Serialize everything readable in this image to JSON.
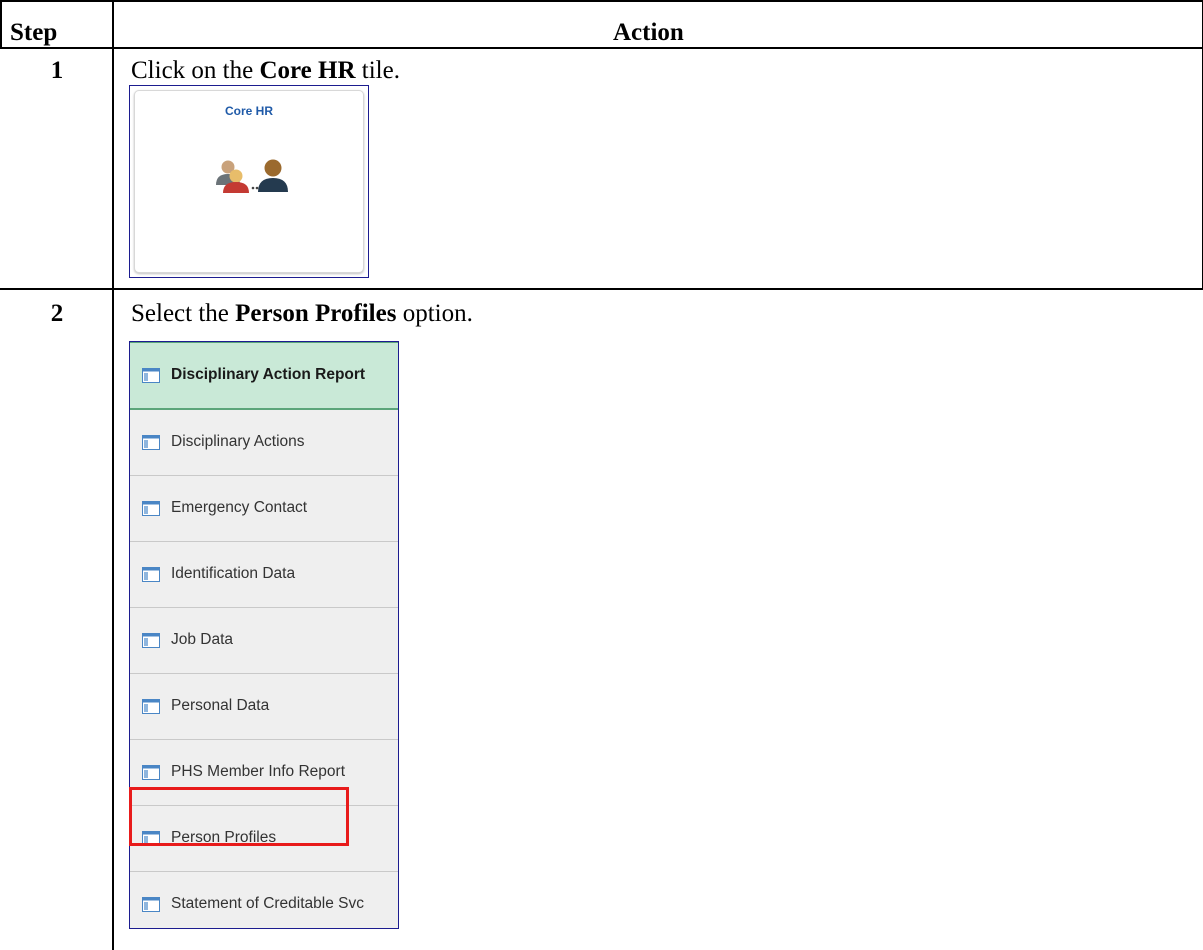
{
  "table": {
    "header": {
      "step": "Step",
      "action": "Action"
    },
    "rows": [
      {
        "step": "1",
        "instruction": {
          "before": "Click on the ",
          "bold": "Core HR",
          "after": " tile."
        },
        "tile": {
          "title": "Core HR",
          "icon": "people-group-icon"
        }
      },
      {
        "step": "2",
        "instruction": {
          "before": "Select the ",
          "bold": "Person Profiles",
          "after": " option."
        },
        "menu": {
          "icon": "component-page-icon",
          "items": [
            {
              "label": "Disciplinary Action Report",
              "active": true
            },
            {
              "label": "Disciplinary Actions"
            },
            {
              "label": "Emergency Contact"
            },
            {
              "label": "Identification Data"
            },
            {
              "label": "Job Data"
            },
            {
              "label": "Personal Data"
            },
            {
              "label": "PHS Member Info Report"
            },
            {
              "label": "Person Profiles",
              "highlighted": true
            },
            {
              "label": "Statement of Creditable Svc"
            }
          ]
        }
      }
    ]
  },
  "colors": {
    "highlight": "#e81b1b",
    "active_item": "#c9e9d7",
    "tile_title": "#1f5aa8"
  }
}
